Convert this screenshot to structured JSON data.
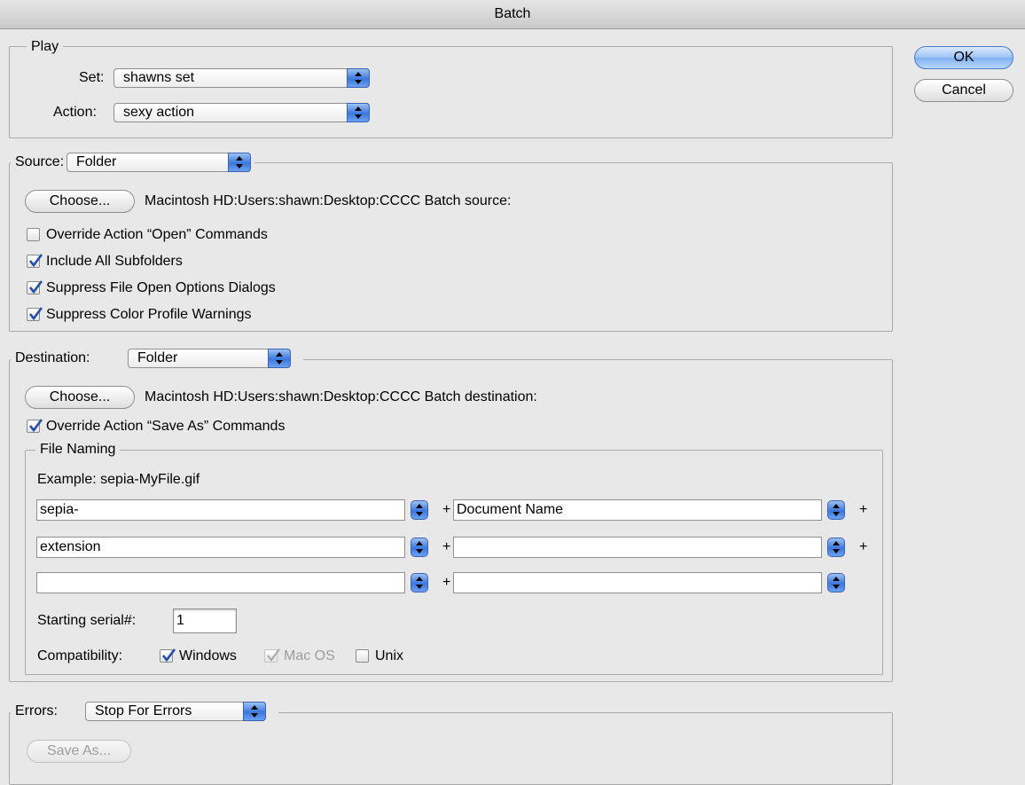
{
  "window": {
    "title": "Batch"
  },
  "buttons": {
    "ok": "OK",
    "cancel": "Cancel"
  },
  "play": {
    "legend": "Play",
    "set_label": "Set:",
    "set_value": "shawns set",
    "action_label": "Action:",
    "action_value": "sexy action"
  },
  "source": {
    "label": "Source:",
    "value": "Folder",
    "choose_label": "Choose...",
    "path": "Macintosh HD:Users:shawn:Desktop:CCCC Batch source:",
    "checkboxes": [
      {
        "label": "Override Action “Open” Commands",
        "checked": false
      },
      {
        "label": "Include All Subfolders",
        "checked": true
      },
      {
        "label": "Suppress File Open Options Dialogs",
        "checked": true
      },
      {
        "label": "Suppress Color Profile Warnings",
        "checked": true
      }
    ]
  },
  "destination": {
    "label": "Destination:",
    "value": "Folder",
    "choose_label": "Choose...",
    "path": "Macintosh HD:Users:shawn:Desktop:CCCC Batch destination:",
    "override_label": "Override Action “Save As” Commands",
    "override_checked": true,
    "file_naming": {
      "legend": "File Naming",
      "example": "Example: sepia-MyFile.gif",
      "plus": "+",
      "rows": [
        {
          "left": "sepia-",
          "right": "Document Name"
        },
        {
          "left": "extension",
          "right": ""
        },
        {
          "left": "",
          "right": ""
        }
      ],
      "serial_label": "Starting serial#:",
      "serial_value": "1",
      "compat_label": "Compatibility:",
      "windows_label": "Windows",
      "windows_checked": true,
      "macos_label": "Mac OS",
      "macos_checked": true,
      "unix_label": "Unix",
      "unix_checked": false
    }
  },
  "errors": {
    "label": "Errors:",
    "value": "Stop For Errors",
    "save_as_label": "Save As..."
  },
  "colors": {
    "accent_blue": "#3a77e0",
    "dialog_bg": "#e8e8e8"
  },
  "icons": {
    "popup_arrows": "updown-arrows-icon",
    "check": "checkmark-icon"
  }
}
